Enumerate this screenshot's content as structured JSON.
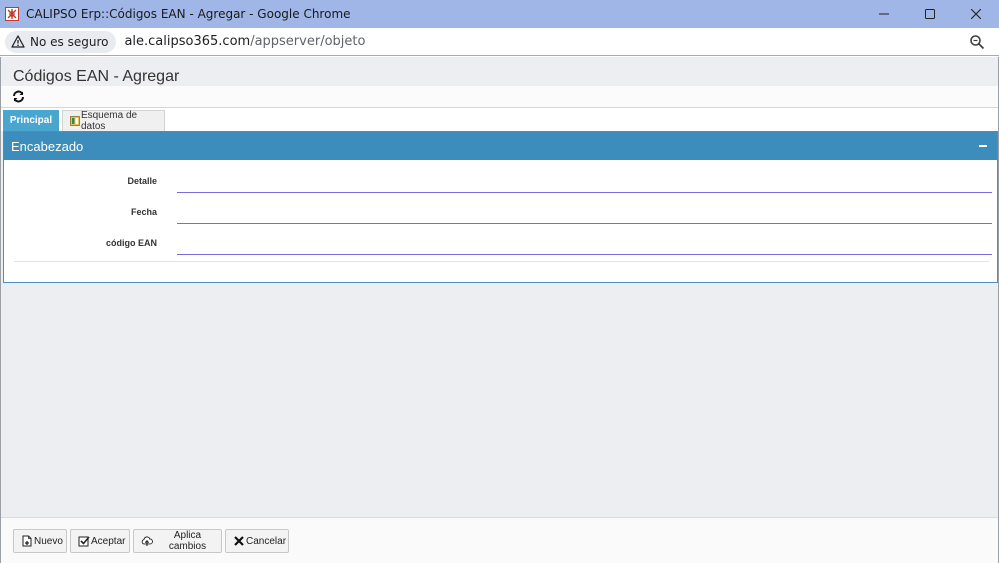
{
  "window": {
    "title": "CALIPSO Erp::Códigos EAN - Agregar - Google Chrome",
    "controls": {
      "minimize": "—",
      "maximize": "☐",
      "close": "✕"
    }
  },
  "address_bar": {
    "security_label": "No es seguro",
    "url_host": "ale.calipso365.com",
    "url_path": "/appserver/objeto"
  },
  "page": {
    "title": "Códigos EAN - Agregar"
  },
  "tabs": [
    {
      "label": "Principal",
      "active": true
    },
    {
      "label": "Esquema de datos",
      "active": false
    }
  ],
  "panel": {
    "title": "Encabezado",
    "fields": [
      {
        "label": "Detalle",
        "value": "",
        "placeholder": ""
      },
      {
        "label": "Fecha",
        "value": "",
        "placeholder": ""
      },
      {
        "label": "código EAN",
        "value": "",
        "placeholder": ""
      }
    ]
  },
  "footer": {
    "buttons": [
      {
        "label": "Nuevo",
        "icon": "new-document-icon"
      },
      {
        "label": "Aceptar",
        "icon": "checkbox-check-icon"
      },
      {
        "label": "Aplica cambios",
        "icon": "cloud-upload-icon"
      },
      {
        "label": "Cancelar",
        "icon": "x-icon"
      }
    ]
  },
  "colors": {
    "titlebar": "#9fb6e6",
    "tab_active": "#48a6cf",
    "panel_header": "#3c8dbc",
    "input_underline": "#7b6cd9"
  }
}
